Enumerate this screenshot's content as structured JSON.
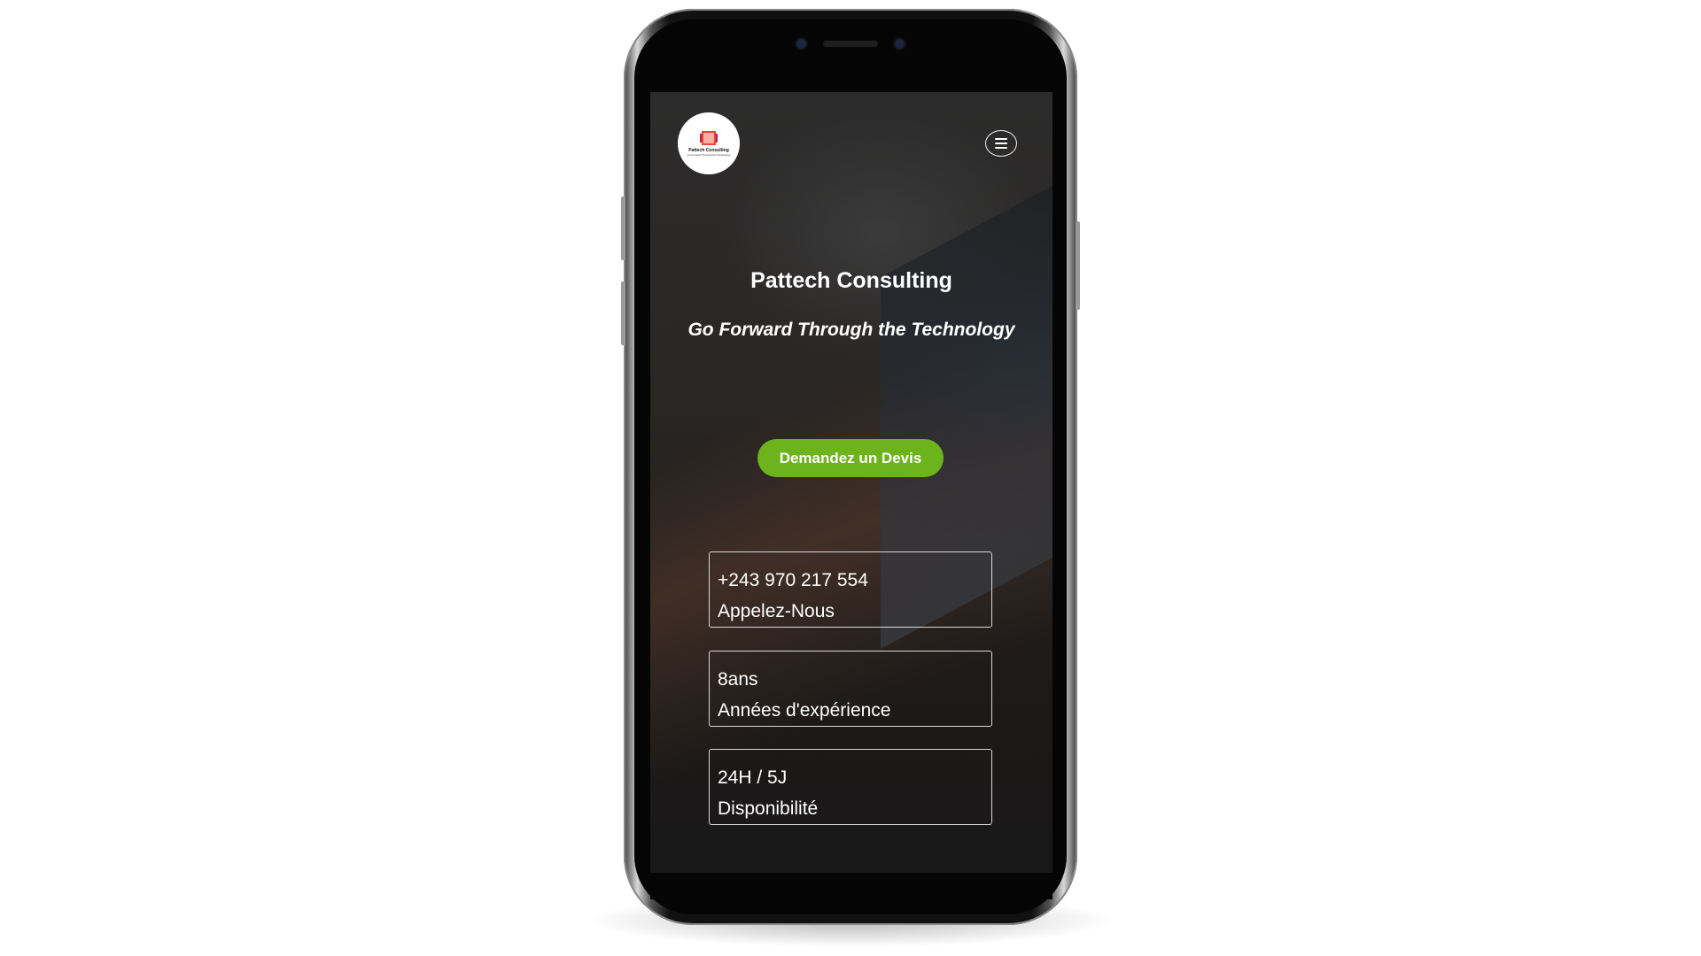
{
  "header": {
    "logo_text": "Pattech Consulting",
    "logo_subtext": "Go Forward Through the Technology",
    "menu_icon": "hamburger-icon"
  },
  "hero": {
    "title": "Pattech Consulting",
    "tagline": "Go Forward Through the Technology",
    "cta_label": "Demandez un Devis"
  },
  "cards": [
    {
      "value": "+243 970 217 554",
      "label": "Appelez-Nous"
    },
    {
      "value": "8ans",
      "label": "Années d'expérience"
    },
    {
      "value": "24H / 5J",
      "label": "Disponibilité"
    }
  ],
  "colors": {
    "accent": "#6db31b",
    "logo_chip": "#e8452c"
  }
}
